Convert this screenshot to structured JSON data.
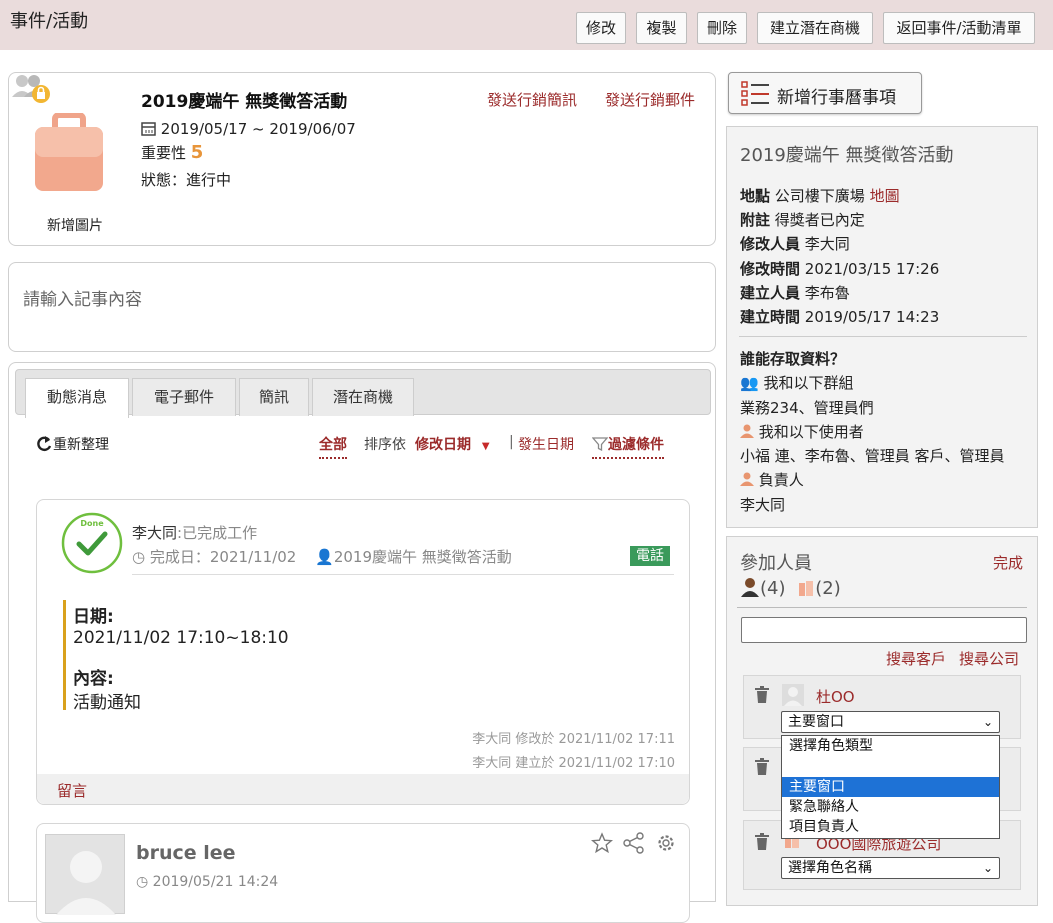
{
  "header": {
    "title": "事件/活動",
    "buttons": {
      "edit": "修改",
      "copy": "複製",
      "delete": "刪除",
      "create_lead": "建立潛在商機",
      "back": "返回事件/活動清單"
    }
  },
  "event": {
    "add_image": "新增圖片",
    "title": "2019慶端午 無獎徵答活動",
    "send_sms": "發送行銷簡訊",
    "send_email": "發送行銷郵件",
    "date_range": "2019/05/17 ~ 2019/06/07",
    "importance_label": "重要性",
    "importance_value": "5",
    "status_label": "狀態：",
    "status_value": "進行中"
  },
  "note": {
    "placeholder": "請輸入記事內容"
  },
  "tabs": [
    "動態消息",
    "電子郵件",
    "簡訊",
    "潛在商機"
  ],
  "toolbar": {
    "refresh": "重新整理",
    "all": "全部",
    "sort_by": "排序依",
    "sort_modified": "修改日期",
    "separator": "|",
    "sort_occurred": "發生日期",
    "filter": "過濾條件"
  },
  "activity1": {
    "stamp": "Done",
    "user": "李大同",
    "action": ":已完成工作",
    "done_label": "完成日：",
    "done_date": "2021/11/02",
    "related": "2019慶端午 無獎徵答活動",
    "badge": "電話",
    "date_heading": "日期:",
    "date_value": "2021/11/02 17:10~18:10",
    "content_heading": "內容:",
    "content_value": "活動通知",
    "modified_line": "李大同 修改於 2021/11/02 17:11",
    "created_line": "李大同 建立於 2021/11/02 17:10",
    "comment": "留言"
  },
  "activity2": {
    "name": "bruce lee",
    "time": "2019/05/21 14:24"
  },
  "sidebar": {
    "add_calendar": "新增行事曆事項",
    "info_title": "2019慶端午 無獎徵答活動",
    "location_label": "地點",
    "location_value": "公司樓下廣場",
    "map_link": "地圖",
    "note_label": "附註",
    "note_value": "得獎者已內定",
    "modifier_label": "修改人員",
    "modifier_value": "李大同",
    "modified_time_label": "修改時間",
    "modified_time_value": "2021/03/15 17:26",
    "creator_label": "建立人員",
    "creator_value": "李布魯",
    "created_time_label": "建立時間",
    "created_time_value": "2019/05/17 14:23",
    "access_title": "誰能存取資料？",
    "groups_label": "我和以下群組",
    "groups_value": "業務234、管理員們",
    "users_label": "我和以下使用者",
    "users_value": "小福 連、李布魯、管理員 客戶、管理員",
    "owner_label": "負責人",
    "owner_value": "李大同"
  },
  "participants": {
    "title": "參加人員",
    "done": "完成",
    "person_count": "(4)",
    "company_count": "(2)",
    "search_customer": "搜尋客戶",
    "search_company": "搜尋公司",
    "p1_name": "杜OO",
    "p1_role": "主要窗口",
    "p3_name": "OOO國際旅遊公司",
    "p3_role": "選擇角色名稱",
    "dropdown_options": [
      "選擇角色類型",
      "",
      "主要窗口",
      "緊急聯絡人",
      "項目負責人"
    ]
  }
}
